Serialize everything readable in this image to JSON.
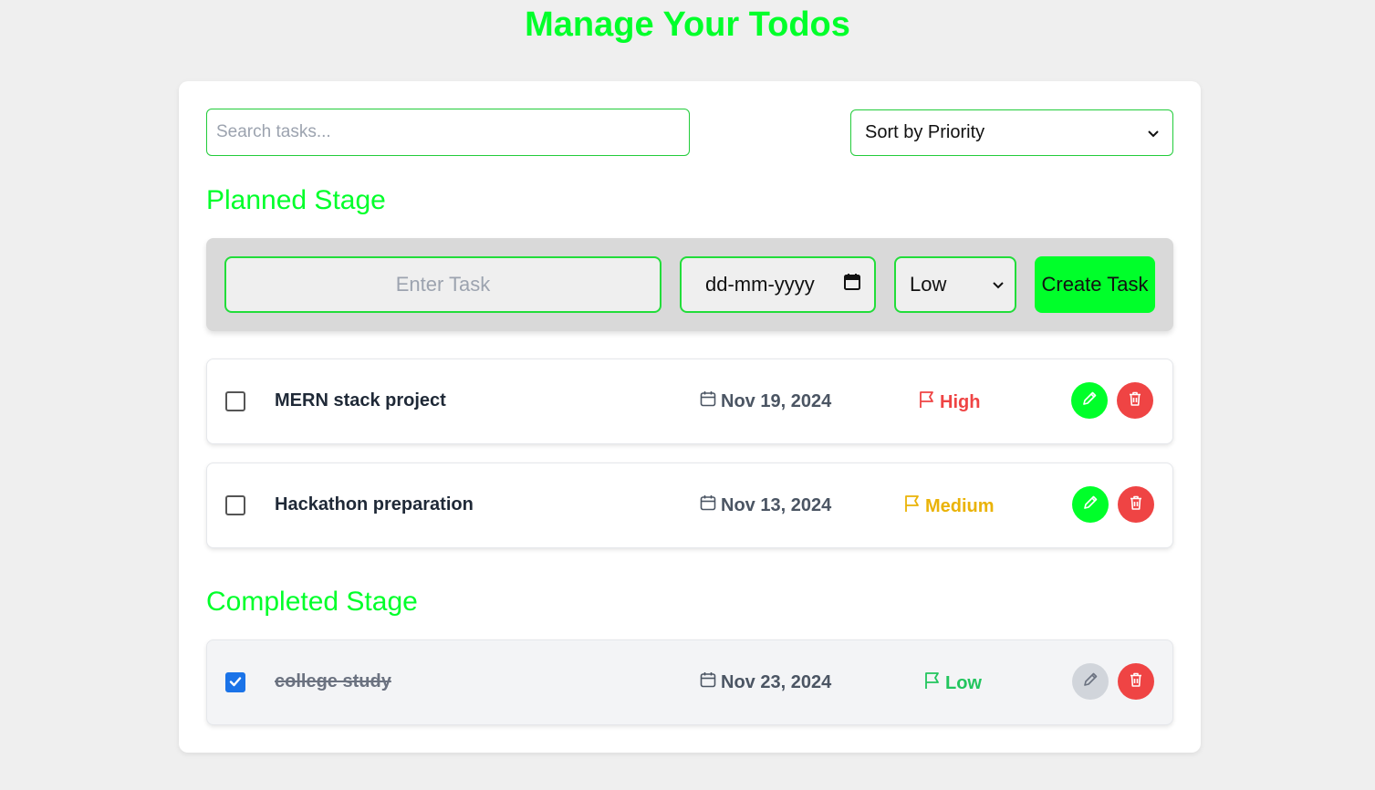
{
  "page": {
    "title": "Manage Your Todos"
  },
  "toolbar": {
    "search_placeholder": "Search tasks...",
    "sort_value": "Sort by Priority"
  },
  "planned": {
    "title": "Planned Stage",
    "create": {
      "task_placeholder": "Enter Task",
      "date_placeholder": "dd-mm-yyyy",
      "priority_value": "Low",
      "button_label": "Create Task"
    },
    "tasks": [
      {
        "name": "MERN stack project",
        "date": "Nov 19, 2024",
        "priority": "High",
        "completed": false
      },
      {
        "name": "Hackathon preparation",
        "date": "Nov 13, 2024",
        "priority": "Medium",
        "completed": false
      }
    ]
  },
  "completed": {
    "title": "Completed Stage",
    "tasks": [
      {
        "name": "college study",
        "date": "Nov 23, 2024",
        "priority": "Low",
        "completed": true
      }
    ]
  },
  "colors": {
    "accent": "#00ff2a",
    "high": "#ef4444",
    "medium": "#eab308",
    "low": "#22c55e",
    "delete": "#ef4444",
    "edit": "#00ff2a",
    "edit_disabled": "#d1d5db"
  }
}
